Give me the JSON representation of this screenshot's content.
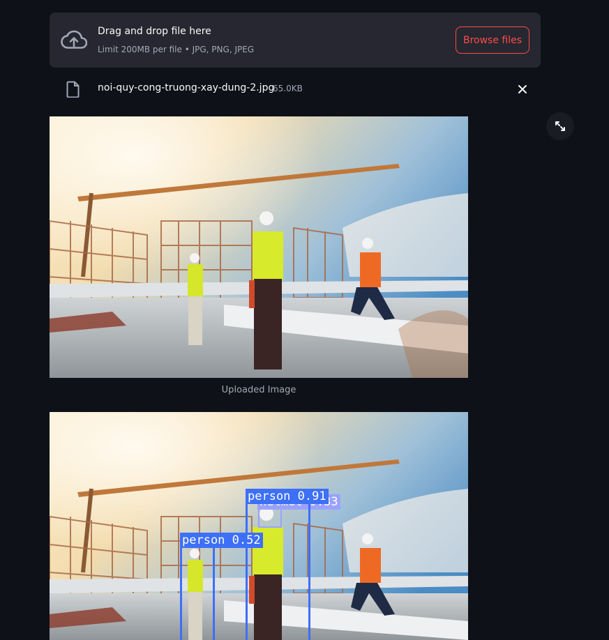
{
  "uploader": {
    "title": "Drag and drop file here",
    "subtitle": "Limit 200MB per file • JPG, PNG, JPEG",
    "browse_label": "Browse files",
    "icon": "cloud-upload-icon"
  },
  "file": {
    "name": "noi-quy-cong-truong-xay-dung-2.jpg",
    "size": "65.0KB",
    "icon": "file-icon",
    "remove_icon": "close-icon"
  },
  "images": {
    "uploaded_caption": "Uploaded Image"
  },
  "detections": [
    {
      "label": "person 0.91"
    },
    {
      "label": "helmet 0.33"
    },
    {
      "label": "person 0.52"
    }
  ],
  "colors": {
    "background": "#0e1117",
    "dropzone": "#262730",
    "accent": "#ff4b4b",
    "bbox_person": "#3d6ff7",
    "bbox_helmet": "#9aa2ff"
  }
}
